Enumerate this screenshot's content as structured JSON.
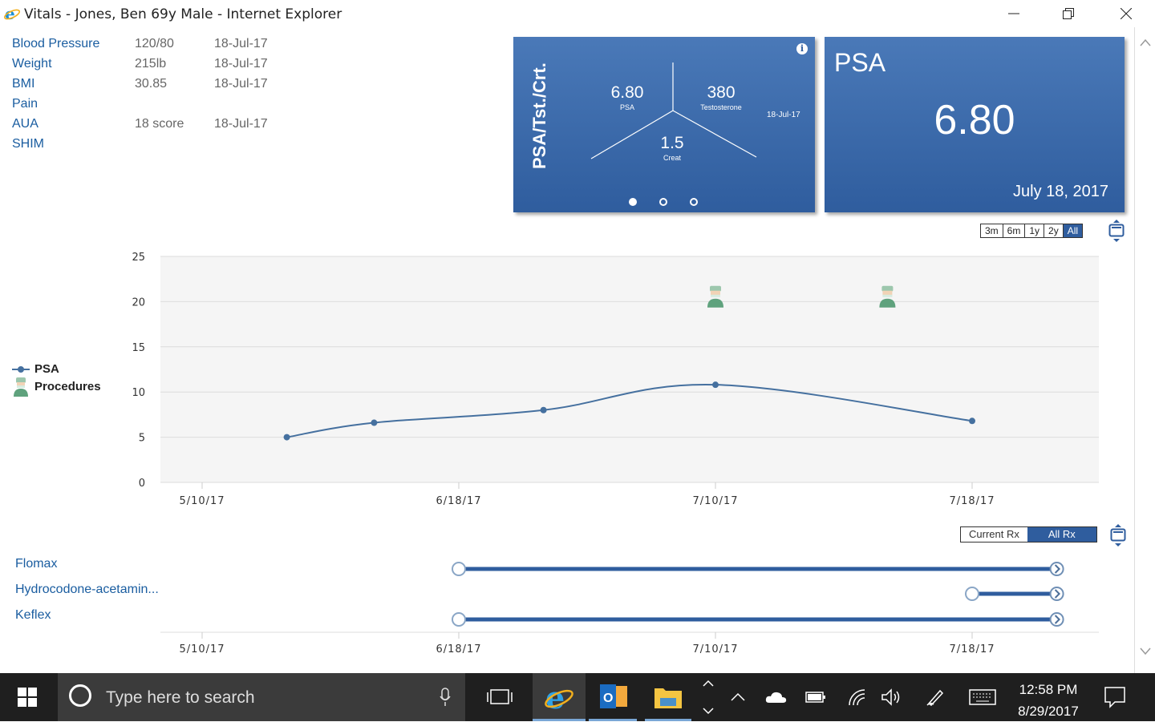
{
  "window": {
    "title": "Vitals - Jones, Ben 69y Male - Internet Explorer"
  },
  "vitals": [
    {
      "label": "Blood Pressure",
      "value": "120/80",
      "date": "18-Jul-17"
    },
    {
      "label": "Weight",
      "value": "215lb",
      "date": "18-Jul-17"
    },
    {
      "label": "BMI",
      "value": "30.85",
      "date": "18-Jul-17"
    },
    {
      "label": "Pain",
      "value": "",
      "date": ""
    },
    {
      "label": "AUA",
      "value": "18 score",
      "date": "18-Jul-17"
    },
    {
      "label": "SHIM",
      "value": "",
      "date": ""
    }
  ],
  "card_ratio": {
    "title": "PSA/Tst./Crt.",
    "psa_value": "6.80",
    "psa_label": "PSA",
    "testosterone_value": "380",
    "testosterone_label": "Testosterone",
    "creat_value": "1.5",
    "creat_label": "Creat",
    "date": "18-Jul-17",
    "info_icon": "i",
    "pages": 3,
    "active_page": 0
  },
  "card_psa": {
    "title": "PSA",
    "value": "6.80",
    "date": "July 18, 2017"
  },
  "range_buttons": [
    "3m",
    "6m",
    "1y",
    "2y",
    "All"
  ],
  "range_active": "All",
  "legend": {
    "psa": "PSA",
    "procedures": "Procedures"
  },
  "colors": {
    "accent": "#2f5d9e",
    "line": "#45709f",
    "link": "#1a5da0"
  },
  "chart_data": {
    "type": "line",
    "title": "",
    "xlabel": "",
    "ylabel": "",
    "ylim": [
      0,
      25
    ],
    "y_ticks": [
      0,
      5,
      10,
      15,
      20,
      25
    ],
    "x_tick_labels": [
      "5/10/17",
      "6/18/17",
      "7/10/17",
      "7/18/17"
    ],
    "series": [
      {
        "name": "PSA",
        "points": [
          {
            "x_index": 0.33,
            "y": 5.0
          },
          {
            "x_index": 0.67,
            "y": 6.6
          },
          {
            "x_index": 1.33,
            "y": 8.0
          },
          {
            "x_index": 2.0,
            "y": 10.8
          },
          {
            "x_index": 3.0,
            "y": 6.8
          }
        ]
      },
      {
        "name": "Procedures",
        "points": [
          {
            "x_index": 2.0,
            "y": 20.5
          },
          {
            "x_index": 2.67,
            "y": 20.5
          }
        ]
      }
    ],
    "grid": true,
    "legend_position": "left"
  },
  "rx_toggle": {
    "current": "Current Rx",
    "all": "All Rx",
    "active": "All Rx"
  },
  "medications": [
    {
      "name": "Flomax",
      "start_index": 1.0,
      "end_index": 3.33
    },
    {
      "name": "Hydrocodone-acetamin...",
      "start_index": 3.0,
      "end_index": 3.33
    },
    {
      "name": "Keflex",
      "start_index": 1.0,
      "end_index": 3.33
    }
  ],
  "med_x_tick_labels": [
    "5/10/17",
    "6/18/17",
    "7/10/17",
    "7/18/17"
  ],
  "taskbar": {
    "search_placeholder": "Type here to search",
    "time": "12:58 PM",
    "date": "8/29/2017"
  }
}
